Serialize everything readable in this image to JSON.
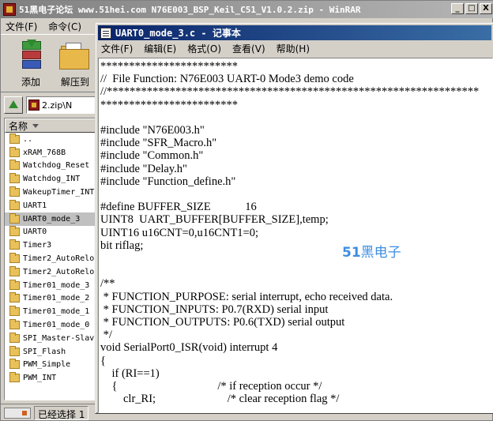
{
  "winrar": {
    "title": "51黑电子论坛 www.51hei.com N76E003_BSP_Keil_C51_V1.0.2.zip - WinRAR",
    "window_buttons": [
      "_",
      "□",
      "X"
    ],
    "menu": [
      "文件(F)",
      "命令(C)"
    ],
    "toolbar": {
      "add_label": "添加",
      "extract_label": "解压到"
    },
    "address": "2.zip\\N",
    "file_list_header": "名称",
    "files": [
      "..",
      "xRAM_768B",
      "Watchdog_Reset",
      "Watchdog_INT",
      "WakeupTimer_INT",
      "UART1",
      "UART0_mode_3",
      "UART0",
      "Timer3",
      "Timer2_AutoRelo",
      "Timer2_AutoRelo",
      "Timer01_mode_3",
      "Timer01_mode_2",
      "Timer01_mode_1",
      "Timer01_mode_0",
      "SPI_Master-Slav",
      "SPI_Flash",
      "PWM_Simple",
      "PWM_INT"
    ],
    "selected_index": 6,
    "status": "已经选择 1"
  },
  "notepad": {
    "title": "UART0_mode_3.c - 记事本",
    "menu": [
      "文件(F)",
      "编辑(E)",
      "格式(O)",
      "查看(V)",
      "帮助(H)"
    ],
    "code_lines": [
      "************************",
      "//  File Function: N76E003 UART-0 Mode3 demo code",
      "//*****************************************************************",
      "************************",
      "",
      "#include \"N76E003.h\"",
      "#include \"SFR_Macro.h\"",
      "#include \"Common.h\"",
      "#include \"Delay.h\"",
      "#include \"Function_define.h\"",
      "",
      "#define BUFFER_SIZE            16",
      "UINT8  UART_BUFFER[BUFFER_SIZE],temp;",
      "UINT16 u16CNT=0,u16CNT1=0;",
      "bit riflag;",
      "",
      "",
      "/**",
      " * FUNCTION_PURPOSE: serial interrupt, echo received data.",
      " * FUNCTION_INPUTS: P0.7(RXD) serial input",
      " * FUNCTION_OUTPUTS: P0.6(TXD) serial output",
      " */",
      "void SerialPort0_ISR(void) interrupt 4",
      "{",
      "    if (RI==1)",
      "    {                                   /* if reception occur */",
      "        clr_RI;                         /* clear reception flag */"
    ]
  },
  "watermark": {
    "number": "51",
    "text": "黑电子"
  }
}
